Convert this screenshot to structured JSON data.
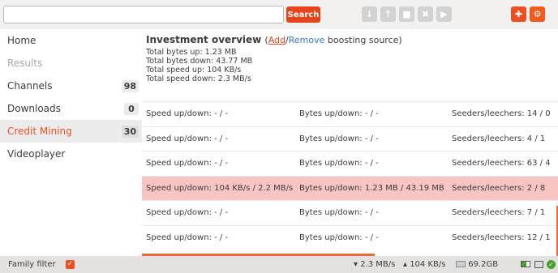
{
  "toolbar": {
    "search_placeholder": "",
    "search_button": "Search",
    "nav_icons": [
      "download-icon",
      "upload-icon",
      "stop-icon",
      "remove-icon",
      "play-icon"
    ],
    "accent_color": "#ee4f22"
  },
  "sidebar": {
    "items": [
      {
        "label": "Home",
        "badge": null
      },
      {
        "label": "Results",
        "badge": null
      },
      {
        "label": "Channels",
        "badge": "98"
      },
      {
        "label": "Downloads",
        "badge": "0"
      },
      {
        "label": "Credit Mining",
        "badge": "30"
      },
      {
        "label": "Videoplayer",
        "badge": null
      }
    ]
  },
  "overview": {
    "title": "Investment overview",
    "open_paren": "(",
    "add_link": "Add",
    "slash": "/",
    "remove_link": "Remove",
    "title_rest": " boosting source)",
    "total_bytes_up": "Total bytes up: 1.23 MB",
    "total_bytes_down": "Total bytes down: 43.77 MB",
    "total_speed_up": "Total speed up: 104 KB/s",
    "total_speed_down": "Total speed down: 2.3 MB/s"
  },
  "rows": [
    {
      "speed": "Speed up/down: - / -",
      "bytes": "Bytes up/down: - / -",
      "seeds": "Seeders/leechers: 14 / 0"
    },
    {
      "speed": "Speed up/down: - / -",
      "bytes": "Bytes up/down: - / -",
      "seeds": "Seeders/leechers: 4 / 1"
    },
    {
      "speed": "Speed up/down: - / -",
      "bytes": "Bytes up/down: - / -",
      "seeds": "Seeders/leechers: 63 / 4"
    },
    {
      "speed": "Speed up/down: 104 KB/s / 2.2 MB/s",
      "bytes": "Bytes up/down: 1.23 MB / 43.19 MB",
      "seeds": "Seeders/leechers: 2 / 8"
    },
    {
      "speed": "Speed up/down: - / -",
      "bytes": "Bytes up/down: - / -",
      "seeds": "Seeders/leechers: 7 / 1"
    },
    {
      "speed": "Speed up/down: - / -",
      "bytes": "Bytes up/down: - / -",
      "seeds": "Seeders/leechers: 12 / 1"
    }
  ],
  "statusbar": {
    "family_filter": "Family filter",
    "download_speed": "▾ 2.3 MB/s",
    "upload_speed": "▴ 104 KB/s",
    "free_space": "69.2GB"
  }
}
